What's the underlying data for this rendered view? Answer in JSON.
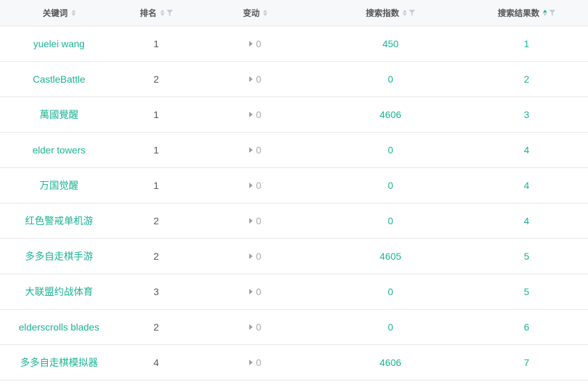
{
  "columns": {
    "keyword": "关键词",
    "rank": "排名",
    "change": "变动",
    "search_index": "搜索指数",
    "result_count": "搜索结果数"
  },
  "colors": {
    "accent": "#1ab394",
    "text": "#555555",
    "muted": "#aaaaaa"
  },
  "rows": [
    {
      "keyword": "yuelei wang",
      "rank": "1",
      "change": "0",
      "index": "450",
      "results": "1"
    },
    {
      "keyword": "CastleBattle",
      "rank": "2",
      "change": "0",
      "index": "0",
      "results": "2"
    },
    {
      "keyword": "萬國覺醒",
      "rank": "1",
      "change": "0",
      "index": "4606",
      "results": "3"
    },
    {
      "keyword": "elder towers",
      "rank": "1",
      "change": "0",
      "index": "0",
      "results": "4"
    },
    {
      "keyword": "万国觉醒",
      "rank": "1",
      "change": "0",
      "index": "0",
      "results": "4"
    },
    {
      "keyword": "红色警戒单机游",
      "rank": "2",
      "change": "0",
      "index": "0",
      "results": "4"
    },
    {
      "keyword": "多多自走棋手游",
      "rank": "2",
      "change": "0",
      "index": "4605",
      "results": "5"
    },
    {
      "keyword": "大联盟约战体育",
      "rank": "3",
      "change": "0",
      "index": "0",
      "results": "5"
    },
    {
      "keyword": "elderscrolls blades",
      "rank": "2",
      "change": "0",
      "index": "0",
      "results": "6"
    },
    {
      "keyword": "多多自走棋模拟器",
      "rank": "4",
      "change": "0",
      "index": "4606",
      "results": "7"
    }
  ]
}
